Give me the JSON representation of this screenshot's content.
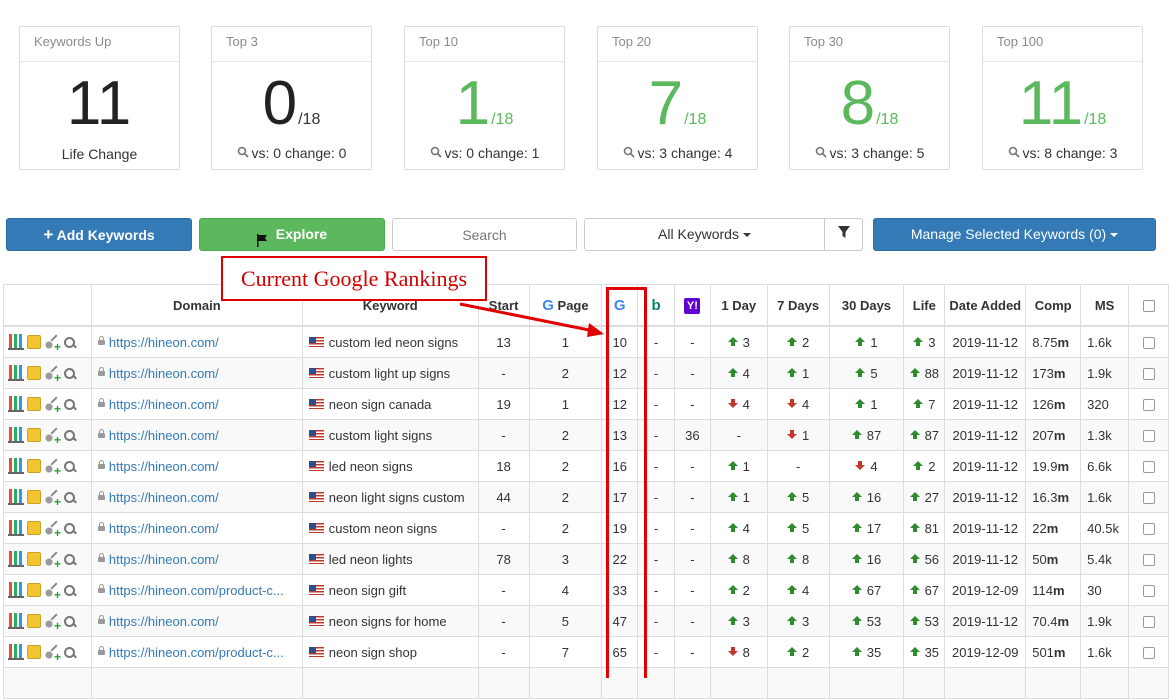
{
  "stats": [
    {
      "title": "Keywords Up",
      "value": "11",
      "denominator": "",
      "footer": "Life Change",
      "footer_icon": "",
      "value_color": "#222222"
    },
    {
      "title": "Top 3",
      "value": "0",
      "denominator": "/18",
      "footer": "vs: 0 change: 0",
      "footer_icon": "search-icon",
      "value_color": "#222222"
    },
    {
      "title": "Top 10",
      "value": "1",
      "denominator": "/18",
      "footer": "vs: 0 change: 1",
      "footer_icon": "search-icon",
      "value_color": "#5cb85c"
    },
    {
      "title": "Top 20",
      "value": "7",
      "denominator": "/18",
      "footer": "vs: 3 change: 4",
      "footer_icon": "search-icon",
      "value_color": "#5cb85c"
    },
    {
      "title": "Top 30",
      "value": "8",
      "denominator": "/18",
      "footer": "vs: 3 change: 5",
      "footer_icon": "search-icon",
      "value_color": "#5cb85c"
    },
    {
      "title": "Top 100",
      "value": "11",
      "denominator": "/18",
      "footer": "vs: 8 change: 3",
      "footer_icon": "search-icon",
      "value_color": "#5cb85c"
    }
  ],
  "toolbar": {
    "add_keywords": "Add Keywords",
    "explore": "Explore",
    "search_placeholder": "Search",
    "filter_select": "All Keywords",
    "manage": "Manage Selected Keywords (0)"
  },
  "annotation": "Current Google Rankings",
  "table": {
    "headers": {
      "domain": "Domain",
      "keyword": "Keyword",
      "start": "Start",
      "page": "Page",
      "day1": "1 Day",
      "day7": "7 Days",
      "day30": "30 Days",
      "life": "Life",
      "date_added": "Date Added",
      "comp": "Comp",
      "ms": "MS"
    },
    "rows": [
      {
        "domain": "https://hineon.com/",
        "keyword": "custom led neon signs",
        "start": "13",
        "page": "1",
        "google": "10",
        "bing": "-",
        "yahoo": "-",
        "d1": {
          "dir": "up",
          "val": "3"
        },
        "d7": {
          "dir": "up",
          "val": "2"
        },
        "d30": {
          "dir": "up",
          "val": "1"
        },
        "life": {
          "dir": "up",
          "val": "3"
        },
        "date": "2019-11-12",
        "comp_num": "8.75",
        "comp_unit": "m",
        "ms": "1.6k"
      },
      {
        "domain": "https://hineon.com/",
        "keyword": "custom light up signs",
        "start": "-",
        "page": "2",
        "google": "12",
        "bing": "-",
        "yahoo": "-",
        "d1": {
          "dir": "up",
          "val": "4"
        },
        "d7": {
          "dir": "up",
          "val": "1"
        },
        "d30": {
          "dir": "up",
          "val": "5"
        },
        "life": {
          "dir": "up",
          "val": "88"
        },
        "date": "2019-11-12",
        "comp_num": "173",
        "comp_unit": "m",
        "ms": "1.9k"
      },
      {
        "domain": "https://hineon.com/",
        "keyword": "neon sign canada",
        "start": "19",
        "page": "1",
        "google": "12",
        "bing": "-",
        "yahoo": "-",
        "d1": {
          "dir": "down",
          "val": "4"
        },
        "d7": {
          "dir": "down",
          "val": "4"
        },
        "d30": {
          "dir": "up",
          "val": "1"
        },
        "life": {
          "dir": "up",
          "val": "7"
        },
        "date": "2019-11-12",
        "comp_num": "126",
        "comp_unit": "m",
        "ms": "320"
      },
      {
        "domain": "https://hineon.com/",
        "keyword": "custom light signs",
        "start": "-",
        "page": "2",
        "google": "13",
        "bing": "-",
        "yahoo": "36",
        "d1": {
          "dir": "none",
          "val": "-"
        },
        "d7": {
          "dir": "down",
          "val": "1"
        },
        "d30": {
          "dir": "up",
          "val": "87"
        },
        "life": {
          "dir": "up",
          "val": "87"
        },
        "date": "2019-11-12",
        "comp_num": "207",
        "comp_unit": "m",
        "ms": "1.3k"
      },
      {
        "domain": "https://hineon.com/",
        "keyword": "led neon signs",
        "start": "18",
        "page": "2",
        "google": "16",
        "bing": "-",
        "yahoo": "-",
        "d1": {
          "dir": "up",
          "val": "1"
        },
        "d7": {
          "dir": "none",
          "val": "-"
        },
        "d30": {
          "dir": "down",
          "val": "4"
        },
        "life": {
          "dir": "up",
          "val": "2"
        },
        "date": "2019-11-12",
        "comp_num": "19.9",
        "comp_unit": "m",
        "ms": "6.6k"
      },
      {
        "domain": "https://hineon.com/",
        "keyword": "neon light signs custom",
        "start": "44",
        "page": "2",
        "google": "17",
        "bing": "-",
        "yahoo": "-",
        "d1": {
          "dir": "up",
          "val": "1"
        },
        "d7": {
          "dir": "up",
          "val": "5"
        },
        "d30": {
          "dir": "up",
          "val": "16"
        },
        "life": {
          "dir": "up",
          "val": "27"
        },
        "date": "2019-11-12",
        "comp_num": "16.3",
        "comp_unit": "m",
        "ms": "1.6k"
      },
      {
        "domain": "https://hineon.com/",
        "keyword": "custom neon signs",
        "start": "-",
        "page": "2",
        "google": "19",
        "bing": "-",
        "yahoo": "-",
        "d1": {
          "dir": "up",
          "val": "4"
        },
        "d7": {
          "dir": "up",
          "val": "5"
        },
        "d30": {
          "dir": "up",
          "val": "17"
        },
        "life": {
          "dir": "up",
          "val": "81"
        },
        "date": "2019-11-12",
        "comp_num": "22",
        "comp_unit": "m",
        "ms": "40.5k"
      },
      {
        "domain": "https://hineon.com/",
        "keyword": "led neon lights",
        "start": "78",
        "page": "3",
        "google": "22",
        "bing": "-",
        "yahoo": "-",
        "d1": {
          "dir": "up",
          "val": "8"
        },
        "d7": {
          "dir": "up",
          "val": "8"
        },
        "d30": {
          "dir": "up",
          "val": "16"
        },
        "life": {
          "dir": "up",
          "val": "56"
        },
        "date": "2019-11-12",
        "comp_num": "50",
        "comp_unit": "m",
        "ms": "5.4k"
      },
      {
        "domain": "https://hineon.com/product-c...",
        "keyword": "neon sign gift",
        "start": "-",
        "page": "4",
        "google": "33",
        "bing": "-",
        "yahoo": "-",
        "d1": {
          "dir": "up",
          "val": "2"
        },
        "d7": {
          "dir": "up",
          "val": "4"
        },
        "d30": {
          "dir": "up",
          "val": "67"
        },
        "life": {
          "dir": "up",
          "val": "67"
        },
        "date": "2019-12-09",
        "comp_num": "114",
        "comp_unit": "m",
        "ms": "30"
      },
      {
        "domain": "https://hineon.com/",
        "keyword": "neon signs for home",
        "start": "-",
        "page": "5",
        "google": "47",
        "bing": "-",
        "yahoo": "-",
        "d1": {
          "dir": "up",
          "val": "3"
        },
        "d7": {
          "dir": "up",
          "val": "3"
        },
        "d30": {
          "dir": "up",
          "val": "53"
        },
        "life": {
          "dir": "up",
          "val": "53"
        },
        "date": "2019-11-12",
        "comp_num": "70.4",
        "comp_unit": "m",
        "ms": "1.9k"
      },
      {
        "domain": "https://hineon.com/product-c...",
        "keyword": "neon sign shop",
        "start": "-",
        "page": "7",
        "google": "65",
        "bing": "-",
        "yahoo": "-",
        "d1": {
          "dir": "down",
          "val": "8"
        },
        "d7": {
          "dir": "up",
          "val": "2"
        },
        "d30": {
          "dir": "up",
          "val": "35"
        },
        "life": {
          "dir": "up",
          "val": "35"
        },
        "date": "2019-12-09",
        "comp_num": "501",
        "comp_unit": "m",
        "ms": "1.6k"
      }
    ]
  }
}
